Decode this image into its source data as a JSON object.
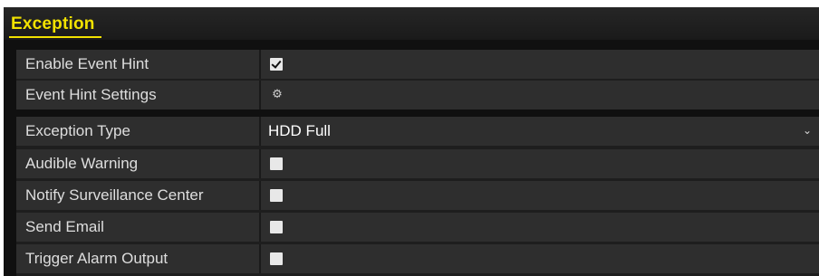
{
  "section": {
    "title": "Exception"
  },
  "general": {
    "enable_event_hint": {
      "label": "Enable Event Hint",
      "checked": true
    },
    "event_hint_settings": {
      "label": "Event Hint Settings",
      "icon": "gear-icon"
    }
  },
  "exception": {
    "type": {
      "label": "Exception Type",
      "value": "HDD Full",
      "icon": "chevron-down-icon"
    },
    "actions": [
      {
        "label": "Audible Warning",
        "checked": false
      },
      {
        "label": "Notify Surveillance Center",
        "checked": false
      },
      {
        "label": "Send Email",
        "checked": false
      },
      {
        "label": "Trigger Alarm Output",
        "checked": false
      }
    ]
  },
  "colors": {
    "title": "#f2e200",
    "panel_background": "#101010",
    "row_background": "#2e2e2e",
    "label_text": "#dedede"
  }
}
